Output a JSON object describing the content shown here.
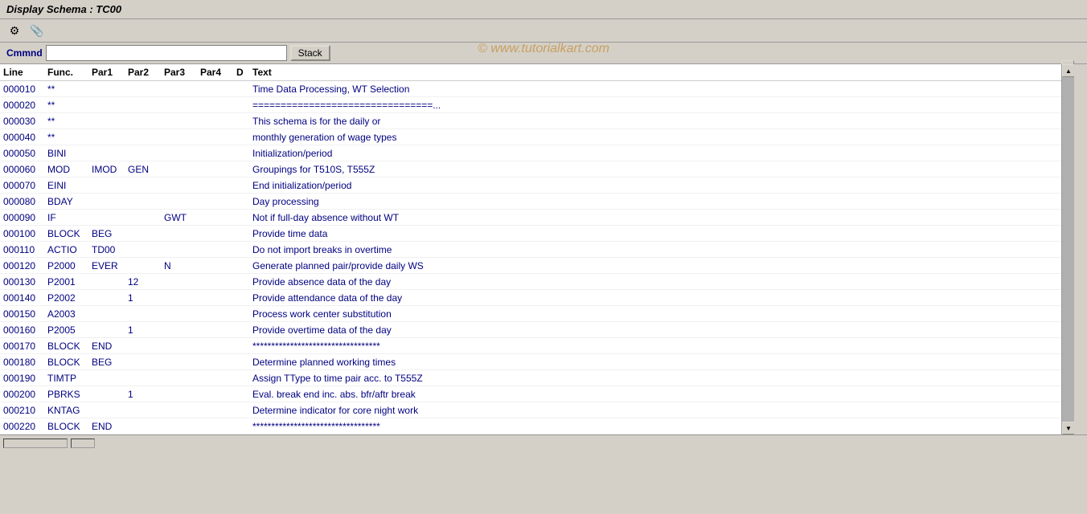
{
  "title": "Display Schema : TC00",
  "watermark": "© www.tutorialkart.com",
  "toolbar": {
    "icons": [
      "⚙",
      "📎"
    ]
  },
  "command": {
    "label": "Cmmnd",
    "placeholder": "",
    "stack_button": "Stack"
  },
  "header": {
    "line": "Line",
    "func": "Func.",
    "par1": "Par1",
    "par2": "Par2",
    "par3": "Par3",
    "par4": "Par4",
    "d": "D",
    "text": "Text"
  },
  "rows": [
    {
      "line": "000010",
      "func": "**",
      "par1": "",
      "par2": "",
      "par3": "",
      "par4": "",
      "d": "",
      "text": "Time Data Processing, WT Selection"
    },
    {
      "line": "000020",
      "func": "**",
      "par1": "",
      "par2": "",
      "par3": "",
      "par4": "",
      "d": "",
      "text": "================================..."
    },
    {
      "line": "000030",
      "func": "**",
      "par1": "",
      "par2": "",
      "par3": "",
      "par4": "",
      "d": "",
      "text": "This schema is for the daily or"
    },
    {
      "line": "000040",
      "func": "**",
      "par1": "",
      "par2": "",
      "par3": "",
      "par4": "",
      "d": "",
      "text": "monthly generation of wage types"
    },
    {
      "line": "000050",
      "func": "BINI",
      "par1": "",
      "par2": "",
      "par3": "",
      "par4": "",
      "d": "",
      "text": "Initialization/period"
    },
    {
      "line": "000060",
      "func": "MOD",
      "par1": "IMOD",
      "par2": "GEN",
      "par3": "",
      "par4": "",
      "d": "",
      "text": "Groupings for T510S, T555Z"
    },
    {
      "line": "000070",
      "func": "EINI",
      "par1": "",
      "par2": "",
      "par3": "",
      "par4": "",
      "d": "",
      "text": "End initialization/period"
    },
    {
      "line": "000080",
      "func": "BDAY",
      "par1": "",
      "par2": "",
      "par3": "",
      "par4": "",
      "d": "",
      "text": "Day processing"
    },
    {
      "line": "000090",
      "func": "IF",
      "par1": "",
      "par2": "",
      "par3": "GWT",
      "par4": "",
      "d": "",
      "text": "Not if full-day absence without WT"
    },
    {
      "line": "000100",
      "func": "BLOCK",
      "par1": "BEG",
      "par2": "",
      "par3": "",
      "par4": "",
      "d": "",
      "text": "Provide time data"
    },
    {
      "line": "000110",
      "func": "ACTIO",
      "par1": "TD00",
      "par2": "",
      "par3": "",
      "par4": "",
      "d": "",
      "text": "Do not import breaks in overtime"
    },
    {
      "line": "000120",
      "func": "P2000",
      "par1": "EVER",
      "par2": "",
      "par3": "N",
      "par4": "",
      "d": "",
      "text": "Generate planned pair/provide daily WS"
    },
    {
      "line": "000130",
      "func": "P2001",
      "par1": "",
      "par2": "12",
      "par3": "",
      "par4": "",
      "d": "",
      "text": "Provide absence data of the day"
    },
    {
      "line": "000140",
      "func": "P2002",
      "par1": "",
      "par2": "1",
      "par3": "",
      "par4": "",
      "d": "",
      "text": "Provide attendance data of the day"
    },
    {
      "line": "000150",
      "func": "A2003",
      "par1": "",
      "par2": "",
      "par3": "",
      "par4": "",
      "d": "",
      "text": "Process work center substitution"
    },
    {
      "line": "000160",
      "func": "P2005",
      "par1": "",
      "par2": "1",
      "par3": "",
      "par4": "",
      "d": "",
      "text": "Provide overtime data of the day"
    },
    {
      "line": "000170",
      "func": "BLOCK",
      "par1": "END",
      "par2": "",
      "par3": "",
      "par4": "",
      "d": "",
      "text": "**********************************"
    },
    {
      "line": "000180",
      "func": "BLOCK",
      "par1": "BEG",
      "par2": "",
      "par3": "",
      "par4": "",
      "d": "",
      "text": "Determine planned working times"
    },
    {
      "line": "000190",
      "func": "TIMTP",
      "par1": "",
      "par2": "",
      "par3": "",
      "par4": "",
      "d": "",
      "text": "Assign TType to time pair acc. to T555Z"
    },
    {
      "line": "000200",
      "func": "PBRKS",
      "par1": "",
      "par2": "1",
      "par3": "",
      "par4": "",
      "d": "",
      "text": "Eval. break end inc. abs. bfr/aftr break"
    },
    {
      "line": "000210",
      "func": "KNTAG",
      "par1": "",
      "par2": "",
      "par3": "",
      "par4": "",
      "d": "",
      "text": "Determine indicator for core night work"
    },
    {
      "line": "000220",
      "func": "BLOCK",
      "par1": "END",
      "par2": "",
      "par3": "",
      "par4": "",
      "d": "",
      "text": "**********************************"
    }
  ]
}
